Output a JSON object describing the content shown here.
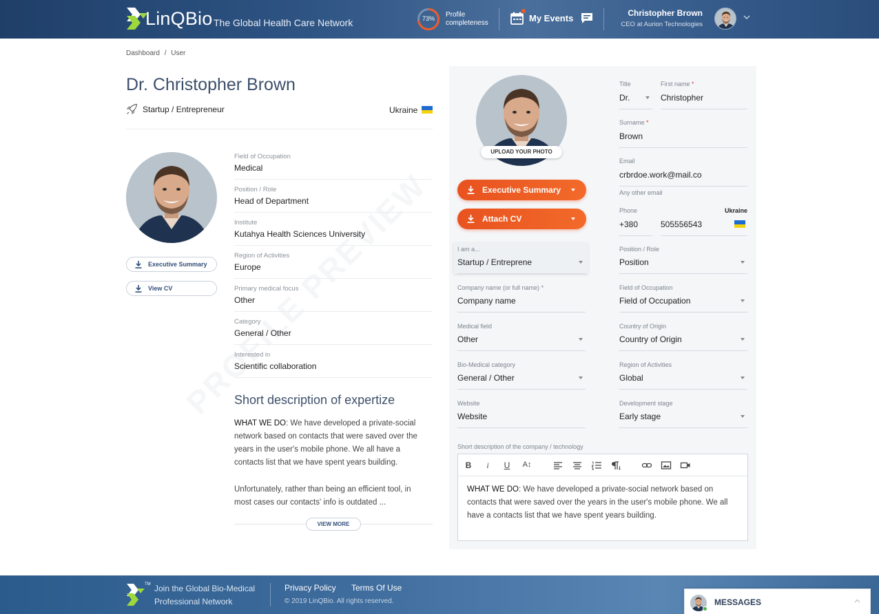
{
  "header": {
    "brand_pre": "LinQ",
    "brand_q": "",
    "brand_post": "Bio",
    "tagline": "The Global Health Care Network",
    "profile_percent": "73%",
    "profile_progress": 0.73,
    "profile_label_1": "Profile",
    "profile_label_2": "completeness",
    "events_label": "My Events",
    "user_name": "Christopher Brown",
    "user_role": "CEO at Aurion Technologies",
    "accent": "#f05a28"
  },
  "breadcrumb": {
    "home": "Dashboard",
    "sep": "/",
    "current": "User"
  },
  "profile": {
    "name": "Dr. Christopher Brown",
    "type": "Startup / Entrepreneur",
    "country": "Ukraine",
    "exec_summary_btn": "Executive Summary",
    "view_cv_btn": "View CV",
    "fields": [
      {
        "label": "Field of Occupation",
        "value": "Medical"
      },
      {
        "label": "Position / Role",
        "value": "Head of Department"
      },
      {
        "label": "Institute",
        "value": "Kutahya Health Sciences University"
      },
      {
        "label": "Region of Activities",
        "value": "Europe"
      },
      {
        "label": "Primary medical focus",
        "value": "Other"
      },
      {
        "label": "Category",
        "value": "General / Other"
      },
      {
        "label": "Interested in",
        "value": "Scientific collaboration"
      }
    ],
    "watermark": "PROFILE PREVIEW",
    "description_title": "Short description of expertize",
    "description_lead": "WHAT WE DO",
    "description_p1": ": We have developed a private-social network based on contacts that were saved over the years in the user's mobile phone. We all have a contacts list that we have spent years building.",
    "description_p2": "Unfortunately, rather than being an efficient tool, in most cases our contacts' info is outdated ...",
    "view_more": "VIEW MORE"
  },
  "form": {
    "upload_photo": "UPLOAD YOUR PHOTO",
    "exec_summary_btn": "Executive Summary",
    "attach_cv_btn": "Attach CV",
    "title_label": "Title",
    "title_value": "Dr.",
    "first_name_label": "First name",
    "first_name_value": "Christopher",
    "surname_label": "Surname",
    "surname_value": "Brown",
    "email_label": "Email",
    "email_value": "crbrdoe.work@mail.co",
    "other_email_label": "Any other email",
    "phone_label": "Phone",
    "phone_country": "Ukraine",
    "phone_code": "+380",
    "phone_number": "505556543",
    "i_am_label": "I am a...",
    "i_am_value": "Startup / Entreprene",
    "position_label": "Position / Role",
    "position_value": "Position",
    "company_label": "Company name (or full name)",
    "company_value": "Company name",
    "occupation_label": "Field of Occupation",
    "occupation_value": "Field of Occupation",
    "medical_field_label": "Medical field",
    "medical_field_value": "Other",
    "origin_label": "Country of Origin",
    "origin_value": "Country of Origin",
    "biomed_label": "Bio-Medical category",
    "biomed_value": "General / Other",
    "region_label": "Region of Activities",
    "region_value": "Global",
    "website_label": "Website",
    "website_value": "Website",
    "stage_label": "Development stage",
    "stage_value": "Early stage",
    "short_desc_label": "Short description of the company / technology",
    "editor_lead": "WHAT WE DO",
    "editor_text": ": We have developed a private-social network based on contacts that were saved over the years in the user's mobile phone. We all have a contacts list that we have spent years building.",
    "toolbar": {
      "bold": "B",
      "italic": "i",
      "underline": "U",
      "size": "A↕"
    }
  },
  "footer": {
    "tm": "TM",
    "join_text": "Join the Global Bio-Medical Professional Network",
    "privacy": "Privacy Policy",
    "terms": "Terms Of Use",
    "copyright": "© 2019 LinQBio. All rights reserved."
  },
  "messages": {
    "label": "MESSAGES"
  }
}
